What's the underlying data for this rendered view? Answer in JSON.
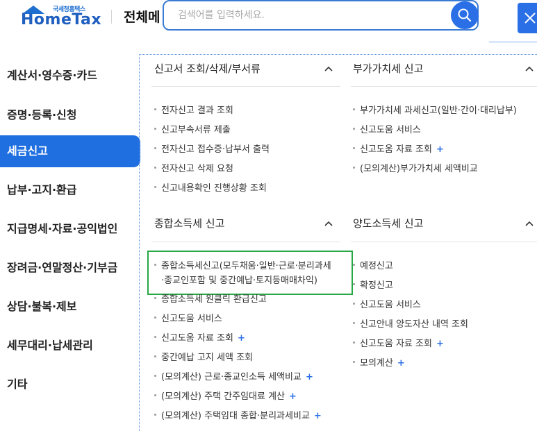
{
  "header": {
    "logo_sub": "국세청홈택스",
    "logo_main": "HomeTax",
    "menu_title": "전체메",
    "search_placeholder": "검색어를 입력하세요."
  },
  "sidebar": {
    "items": [
      {
        "label": "계산서·영수증·카드"
      },
      {
        "label": "증명·등록·신청"
      },
      {
        "label": "세금신고",
        "active": true
      },
      {
        "label": "납부·고지·환급"
      },
      {
        "label": "지급명세·자료·공익법인"
      },
      {
        "label": "장려금·연말정산·기부금"
      },
      {
        "label": "상담·불복·제보"
      },
      {
        "label": "세무대리·납세관리"
      },
      {
        "label": "기타"
      }
    ]
  },
  "sections": {
    "s1": {
      "title": "신고서 조회/삭제/부서류",
      "items": [
        {
          "label": "전자신고 결과 조회"
        },
        {
          "label": "신고부속서류 제출"
        },
        {
          "label": "전자신고 접수증·납부서 출력"
        },
        {
          "label": "전자신고 삭제 요청"
        },
        {
          "label": "신고내용확인 진행상황 조회"
        }
      ]
    },
    "s2": {
      "title": "부가가치세 신고",
      "items": [
        {
          "label": "부가가치세 과세신고(일반·간이·대리납부)"
        },
        {
          "label": "신고도움 서비스"
        },
        {
          "label": "신고도움 자료 조회",
          "plus": "+"
        },
        {
          "label": "(모의계산)부가가치세 세액비교"
        }
      ]
    },
    "s3": {
      "title": "종합소득세 신고",
      "items": [
        {
          "label": "종합소득세신고(모두채움·일반·근로·분리과세"
        },
        {
          "label": "·종교인포함 및 중간예납·토지등매매차익)"
        },
        {
          "label": "종합소득세 원클릭 환급신고"
        },
        {
          "label": "신고도움 서비스"
        },
        {
          "label": "신고도움 자료 조회",
          "plus": "+"
        },
        {
          "label": "중간예납 고지 세액 조회"
        },
        {
          "label": "(모의계산) 근로·종교인소득 세액비교",
          "plus": "+"
        },
        {
          "label": "(모의계산) 주택 간주임대료 계산",
          "plus": "+"
        },
        {
          "label": "(모의계산) 주택임대 종합·분리과세비교",
          "plus": "+"
        }
      ]
    },
    "s4": {
      "title": "양도소득세 신고",
      "items": [
        {
          "label": "예정신고"
        },
        {
          "label": "확정신고"
        },
        {
          "label": "신고도움 서비스"
        },
        {
          "label": "신고안내 양도자산 내역 조회"
        },
        {
          "label": "신고도움 자료 조회",
          "plus": "+"
        },
        {
          "label": "모의계산",
          "plus": "+"
        }
      ]
    }
  },
  "colors": {
    "accent": "#1f6fe0",
    "highlight": "#27a845",
    "plus": "#2a6fe6"
  }
}
